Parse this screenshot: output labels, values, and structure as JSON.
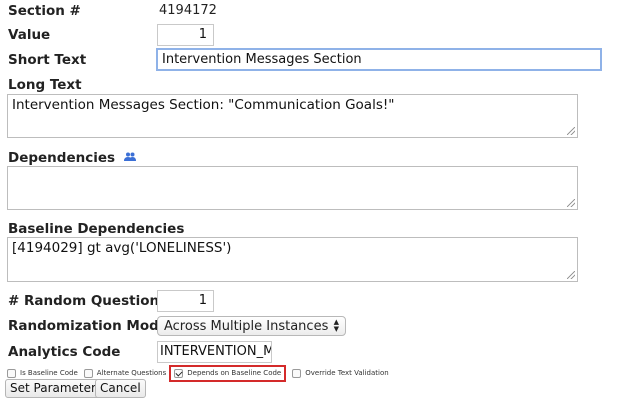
{
  "section": {
    "label": "Section #",
    "value": "4194172"
  },
  "value": {
    "label": "Value",
    "value": "1"
  },
  "short_text": {
    "label": "Short Text",
    "value": "Intervention Messages Section"
  },
  "long_text": {
    "label": "Long Text",
    "value": "Intervention Messages Section: \"Communication Goals!\""
  },
  "dependencies": {
    "label": "Dependencies",
    "value": "",
    "icon": "users-icon"
  },
  "baseline_dependencies": {
    "label": "Baseline Dependencies",
    "value": "[4194029] gt avg('LONELINESS')"
  },
  "random_questions": {
    "label": "# Random Questions",
    "value": "1"
  },
  "randomization_mode": {
    "label": "Randomization Mode",
    "selected": "Across Multiple Instances"
  },
  "analytics_code": {
    "label": "Analytics Code",
    "value": "INTERVENTION_MES!"
  },
  "checkboxes": {
    "is_baseline_code": {
      "label": "Is Baseline Code",
      "checked": false
    },
    "alternate_questions": {
      "label": "Alternate Questions",
      "checked": false
    },
    "depends_on_baseline_code": {
      "label": "Depends on Baseline Code",
      "checked": true
    },
    "override_text_validation": {
      "label": "Override Text Validation",
      "checked": false
    }
  },
  "buttons": {
    "set_parameters": "Set Parameters",
    "cancel": "Cancel"
  },
  "colors": {
    "highlight": "#d42a2a",
    "focus": "#8fb2e8",
    "icon": "#3b6fd6"
  }
}
